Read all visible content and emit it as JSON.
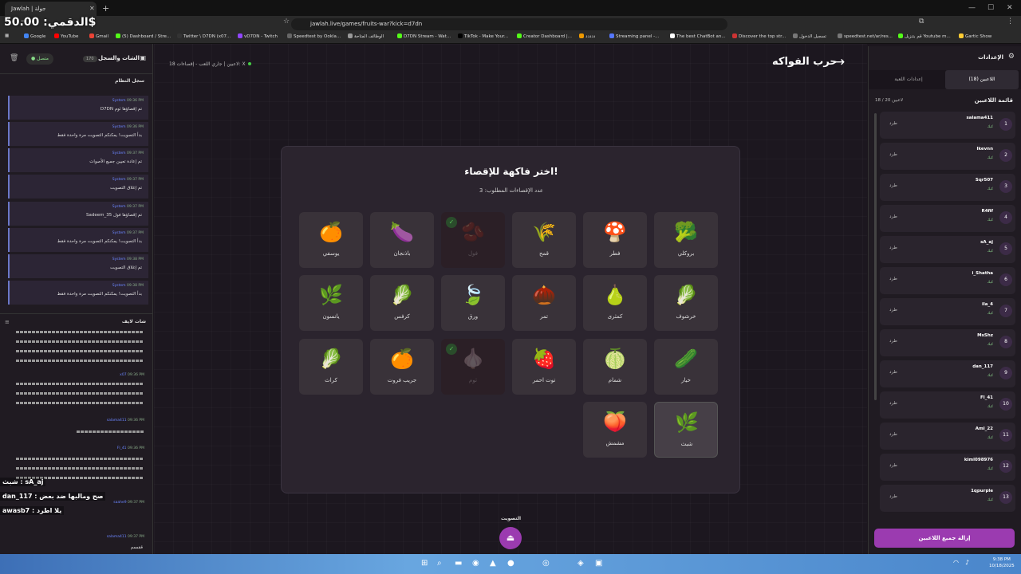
{
  "browser": {
    "tab_title": "Jawlah | جولة",
    "url": "jawlah.live/games/fruits-war?kick=d7dn",
    "bookmarks": [
      "Google",
      "YouTube",
      "Gmail",
      "(5) Dashboard / Stre...",
      "Twitter \\ D7DN (x07...",
      "vD7DN - Twitch",
      "Speedtest by Ookla...",
      "الوظائف المتاحة",
      "D7DN Stream - Wat...",
      "TikTok - Make Your...",
      "Creator Dashboard |...",
      "ددددد",
      "Streaming panel -...",
      "The best ChatBot an...",
      "Discover the top str...",
      "تسجيل الدخول",
      "speedtest.net/ar/res...",
      "قم بتنزيل Youtube m...",
      "Gartic Show"
    ]
  },
  "overlay": {
    "dq": "الدقمي: 50.00$",
    "line1": "شبث : sA_aj",
    "line2": "dan_117 : صح ومالبها ضد بعض",
    "line3": "awasb7 : يلا اطرد"
  },
  "left_panel": {
    "title": "الشات والسجل",
    "badge": "170",
    "connection": "متصل",
    "syslog_title": "سجل النظام",
    "logs": [
      {
        "time": "09:36 PM",
        "src": "System",
        "text": "D7DN تم إقصاؤها ثوم"
      },
      {
        "time": "09:36 PM",
        "src": "System",
        "text": "بدأ التصويت! يمكنكم التصويت مرة واحدة فقط"
      },
      {
        "time": "09:37 PM",
        "src": "System",
        "text": "تم إعادة تعيين جميع الأصوات"
      },
      {
        "time": "09:37 PM",
        "src": "System",
        "text": "تم إغلاق التصويت"
      },
      {
        "time": "09:37 PM",
        "src": "System",
        "text": "Sadeem_35 تم إقصاؤها فول"
      },
      {
        "time": "09:37 PM",
        "src": "System",
        "text": "بدأ التصويت! يمكنكم التصويت مرة واحدة فقط"
      },
      {
        "time": "09:38 PM",
        "src": "System",
        "text": "تم إغلاق التصويت"
      },
      {
        "time": "09:38 PM",
        "src": "System",
        "text": "بدأ التصويت! يمكنكم التصويت مرة واحدة فقط"
      }
    ],
    "livechat_title": "شات لايف",
    "chat": [
      {
        "user": "x07",
        "time": "09:36 PM"
      },
      {
        "user": "salama411",
        "time": "09:36 PM"
      },
      {
        "user": "Fl_41",
        "time": "09:36 PM"
      },
      {
        "user": "saahe9",
        "time": "09:37 PM"
      },
      {
        "user": "salama411",
        "time": "09:37 PM",
        "text": "ققممم"
      }
    ]
  },
  "main": {
    "status": "18 لاعبين | جاري اللعب - إقصاءات: X",
    "game_title": "حرب الفواكه",
    "card_title": "اختر فاكهة للإقصاء!",
    "card_sub": "عدد الإقصاءات المطلوب: 3",
    "vote_label": "التصويت",
    "tiles": [
      {
        "name": "بروكلي",
        "emoji": "🥦",
        "state": "normal"
      },
      {
        "name": "فطر",
        "emoji": "🍄",
        "state": "normal"
      },
      {
        "name": "قمح",
        "emoji": "🌾",
        "state": "normal"
      },
      {
        "name": "فول",
        "emoji": "🫘",
        "state": "eliminated"
      },
      {
        "name": "باذنجان",
        "emoji": "🍆",
        "state": "normal"
      },
      {
        "name": "يوسفي",
        "emoji": "🍊",
        "state": "normal"
      },
      {
        "name": "خرشوف",
        "emoji": "🥬",
        "state": "normal"
      },
      {
        "name": "كمثرى",
        "emoji": "🍐",
        "state": "normal"
      },
      {
        "name": "تمر",
        "emoji": "🌰",
        "state": "normal"
      },
      {
        "name": "ورق",
        "emoji": "🍃",
        "state": "normal"
      },
      {
        "name": "كرفس",
        "emoji": "🥬",
        "state": "normal"
      },
      {
        "name": "يانسون",
        "emoji": "🌿",
        "state": "normal"
      },
      {
        "name": "خيار",
        "emoji": "🥒",
        "state": "normal"
      },
      {
        "name": "شمام",
        "emoji": "🍈",
        "state": "normal"
      },
      {
        "name": "توت احمر",
        "emoji": "🍓",
        "state": "normal"
      },
      {
        "name": "ثوم",
        "emoji": "🧄",
        "state": "eliminated"
      },
      {
        "name": "جريب فروت",
        "emoji": "🍊",
        "state": "normal"
      },
      {
        "name": "كراث",
        "emoji": "🥬",
        "state": "normal"
      },
      {
        "name": "شبث",
        "emoji": "🌿",
        "state": "selected"
      },
      {
        "name": "مشمش",
        "emoji": "🍑",
        "state": "normal"
      }
    ]
  },
  "right_panel": {
    "title": "الإعدادات",
    "tab_players": "اللاعبين (18)",
    "tab_game": "إعدادات اللعبة",
    "list_title": "قائمة اللاعبين",
    "list_count": "18 / 20 لاعبين",
    "kick_label": "طرد",
    "player_sub": "كيك",
    "players": [
      "salama411",
      "lkevnn",
      "Sqr507",
      "R4fif",
      "sA_aj",
      "i_Shatha",
      "ila_4",
      "MsShz",
      "dan_117",
      "Fl_41",
      "Aml_22",
      "kiml098976",
      "1qpurple"
    ],
    "kick_all": "إزالة جميع اللاعبين"
  },
  "taskbar": {
    "time": "9:38 PM",
    "date": "10/18/2025"
  }
}
